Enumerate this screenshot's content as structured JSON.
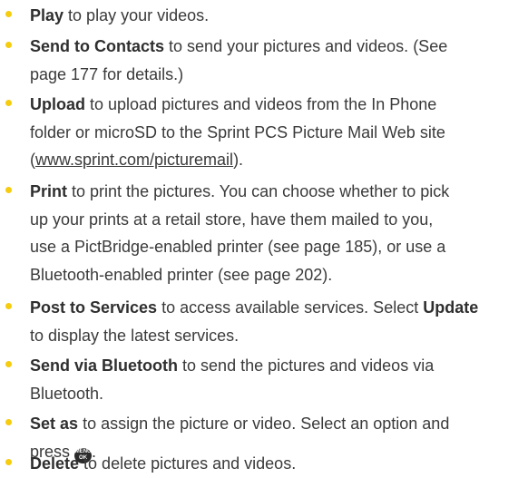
{
  "items": [
    {
      "term": "Play",
      "desc": "to play your videos."
    },
    {
      "term": "Send to Contacts",
      "desc_line1": "to send your pictures and videos. (See",
      "desc_line2": "page 177 for details.)"
    },
    {
      "term": "Upload",
      "desc_line1": "to upload pictures and videos from the In Phone",
      "desc_line2": "folder or microSD to the Sprint PCS Picture Mail Web site",
      "link_open": "(",
      "link": "www.sprint.com/picturemail",
      "link_close": ")."
    },
    {
      "term": "Print",
      "desc_line1": "to print the pictures. You can choose whether to pick",
      "desc_line2": "up your prints at a retail store, have them mailed to you,",
      "desc_line3": "use a PictBridge-enabled printer (see page 185), or use a",
      "desc_line4": "Bluetooth-enabled printer (see page 202)."
    },
    {
      "term": "Post to Services",
      "desc_line1a": "to access available services. Select",
      "term2": "Update",
      "desc_line2": "to display the latest services."
    },
    {
      "term": "Send via Bluetooth",
      "desc_line1": "to send the pictures and videos via",
      "desc_line2": "Bluetooth."
    },
    {
      "term": "Set as",
      "desc_line1": "to assign the picture or video. Select an option and",
      "desc_line2a": "press",
      "key_top": "MENU",
      "key_bottom": "OK",
      "desc_line2b": "."
    },
    {
      "term": "Delete",
      "desc": "to delete pictures and videos."
    }
  ],
  "colors": {
    "bullet": "#f5cc0e",
    "text": "#3a3a3a"
  }
}
